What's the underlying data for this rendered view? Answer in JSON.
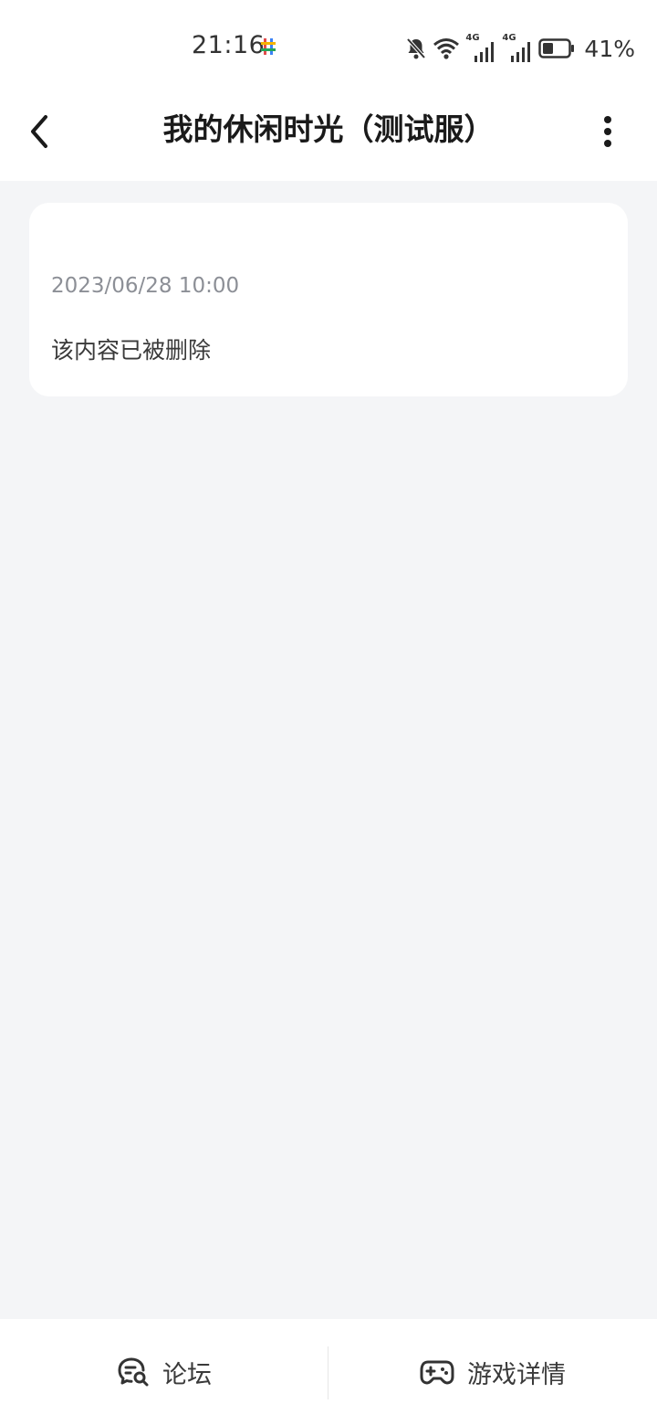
{
  "status_bar": {
    "time": "21:16",
    "battery_percent": "41%",
    "network_labels": [
      "4G",
      "4G"
    ],
    "icons": [
      "app-notification-icon",
      "bell-off-icon",
      "wifi-icon",
      "signal-icon",
      "signal-icon",
      "battery-icon"
    ],
    "battery_level": 0.41
  },
  "header": {
    "title": "我的休闲时光（测试服）",
    "back_icon": "chevron-left-icon",
    "more_icon": "more-vertical-icon"
  },
  "post": {
    "date": "2023/06/28 10:00",
    "content": "该内容已被删除"
  },
  "bottom_bar": {
    "forum_label": "论坛",
    "forum_icon": "chat-search-icon",
    "details_label": "游戏详情",
    "details_icon": "gamepad-icon"
  },
  "colors": {
    "background": "#f4f5f7",
    "surface": "#ffffff",
    "muted_text": "#8c8f96",
    "primary_text": "#1a1a1a"
  }
}
